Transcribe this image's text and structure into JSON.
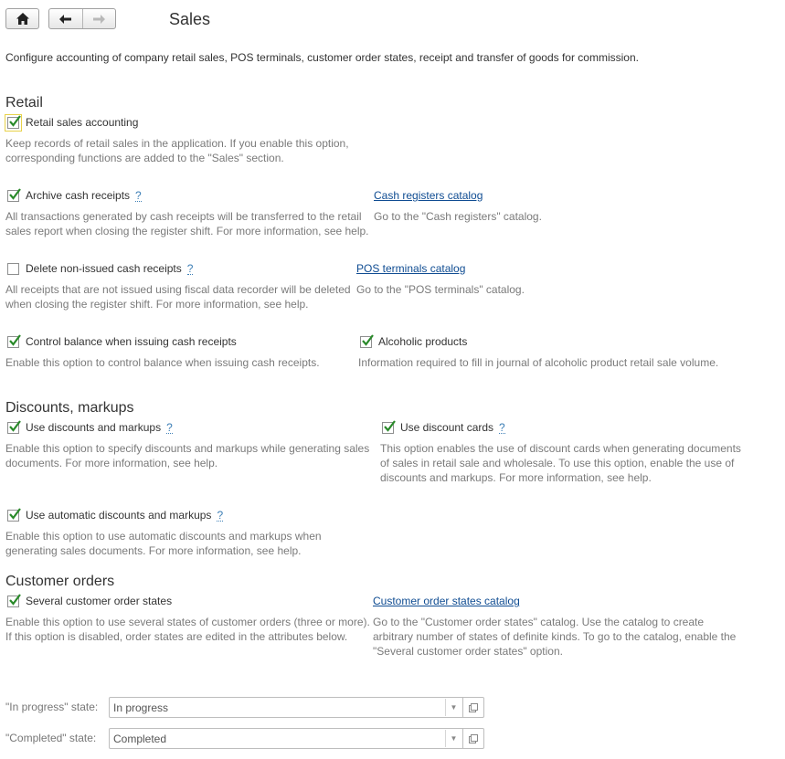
{
  "toolbar": {
    "home_icon": "home-icon",
    "back_icon": "arrow-left-icon",
    "forward_icon": "arrow-right-icon"
  },
  "title": "Sales",
  "intro": "Configure accounting of company retail sales, POS terminals, customer order states, receipt and transfer of goods for commission.",
  "retail": {
    "heading": "Retail",
    "retail_sales": {
      "label": "Retail sales accounting",
      "checked": true,
      "desc": "Keep records of retail sales in the application. If you enable this option, corresponding functions are added to the \"Sales\" section."
    },
    "archive_receipts": {
      "label": "Archive cash receipts",
      "help": "?",
      "checked": true,
      "desc": "All transactions generated by cash receipts will be transferred to the retail sales report when closing the register shift. For more information, see help."
    },
    "cash_registers": {
      "link": "Cash registers catalog",
      "desc": "Go to the \"Cash registers\" catalog."
    },
    "delete_non_issued": {
      "label": "Delete non-issued cash receipts",
      "help": "?",
      "checked": false,
      "desc": "All receipts that are not issued using fiscal data recorder will be deleted when closing the register shift. For more information, see help."
    },
    "pos_terminals": {
      "link": "POS terminals catalog",
      "desc": "Go to the \"POS terminals\" catalog."
    },
    "control_balance": {
      "label": "Control balance when issuing cash receipts",
      "checked": true,
      "desc": "Enable this option to control balance when issuing cash receipts."
    },
    "alcoholic": {
      "label": "Alcoholic products",
      "checked": true,
      "desc": "Information required to fill in journal of alcoholic product retail sale volume."
    }
  },
  "discounts": {
    "heading": "Discounts, markups",
    "use_discounts": {
      "label": "Use discounts and markups",
      "help": "?",
      "checked": true,
      "desc": "Enable this option to specify discounts and markups while generating sales documents. For more information, see help."
    },
    "discount_cards": {
      "label": "Use discount cards",
      "help": "?",
      "checked": true,
      "desc": "This option enables the use of discount cards when generating documents of sales in retail sale and wholesale. To use this option, enable the use of discounts and markups. For more information, see help."
    },
    "automatic": {
      "label": "Use automatic discounts and markups",
      "help": "?",
      "checked": true,
      "desc": "Enable this option to use automatic discounts and markups when generating sales documents. For more information, see help."
    }
  },
  "orders": {
    "heading": "Customer orders",
    "several_states": {
      "label": "Several customer order states",
      "checked": true,
      "desc": "Enable this option to use several states of customer orders (three or more). If this option is disabled, order states are edited in the attributes below."
    },
    "states_catalog": {
      "link": "Customer order states catalog",
      "desc": "Go to the \"Customer order states\" catalog. Use the catalog to create arbitrary number of states of definite kinds. To go to the catalog, enable the \"Several customer order states\" option."
    },
    "in_progress": {
      "label": "\"In progress\" state:",
      "value": "In progress"
    },
    "completed": {
      "label": "\"Completed\" state:",
      "value": "Completed"
    }
  }
}
